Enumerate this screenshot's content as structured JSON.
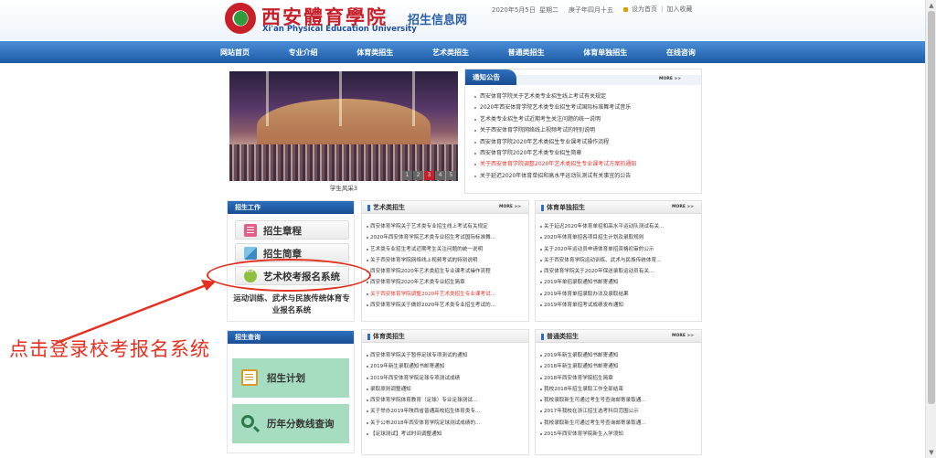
{
  "header": {
    "logo_cn": "西安體育學院",
    "logo_en": "Xi'an Physical Education University",
    "site_name": "招生信息网",
    "date": "2020年5月5日",
    "weekday": "星期二",
    "lunar": "庚子年四月十五",
    "links": [
      "设为首页",
      "加入收藏"
    ]
  },
  "nav": [
    "网站首页",
    "专业介绍",
    "体育类招生",
    "艺术类招生",
    "普通类招生",
    "体育单独招生",
    "在线咨询"
  ],
  "photo": {
    "caption": "学生风采3",
    "dots": [
      "1",
      "2",
      "3",
      "4",
      "5"
    ],
    "active_dot": 2
  },
  "notice": {
    "title": "通知公告",
    "more": "MORE >>",
    "items": [
      "西安体育学院关于艺术类专业招生线上考试有关规定",
      "2020年西安体育学院艺术类专业招生考试国际标准舞考试音乐",
      "艺术类专业招生考试近期考生关注问题的统一说明",
      "关于西安体育学院网络线上视频考试的特别说明",
      "西安体育学院2020年艺术类招生专业课考试操作流程",
      "西安体育学院2020年艺术类专业招生简章",
      "关于西安体育学院调整2020年艺术类招生专业课考试方案的通知",
      "关于延迟2020年体育单招和高水平运动队测试有关事宜的公告"
    ],
    "red_index": 6
  },
  "work": {
    "title": "招生工作",
    "buttons": [
      "招生章程",
      "招生简章",
      "艺术校考报名系统"
    ],
    "extra": "运动训练、武术与民族传统体育专业报名系统"
  },
  "query": {
    "title": "招生查询",
    "buttons": [
      "招生计划",
      "历年分数线查询"
    ]
  },
  "art_box": {
    "title": "艺术类招生",
    "more": "MORE >>",
    "items": [
      "西安体育学院关于艺术类专业招生线上考试有关规定",
      "2020年西安体育学院艺术类专业招生考试国际标准舞...",
      "艺术类专业招生考试近期考生关注问题的统一说明",
      "关于西安体育学院网络线上视频考试的特别说明",
      "西安体育学院2020年艺术类招生专业课考试操作流程",
      "西安体育学院2020年艺术类专业招生简章",
      "关于西安体育学院调整2020年艺术类招生专业课考试...",
      "西安体育学院关于做好2020年艺术类专业招生考试的..."
    ],
    "red_index": 6
  },
  "sport_single_box": {
    "title": "体育单独招生",
    "more": "MORE >>",
    "items": [
      "关于延迟2020年体育单招和高水平运动队测试有关...",
      "2020年体育单招各项目招生计划及录取规则",
      "关于2020年运动员申请体育单招资格初审的公示",
      "关于西安体育学院运动训练、武术与民族传统体育...",
      "西安体育学院关于2020年保送录取运动员有关...",
      "2019年单招录取通知书邮寄通知",
      "2019年体育单招录取办法及录取结果",
      "2019年体育单招考试成绩发布通知"
    ]
  },
  "sport_box": {
    "title": "体育类招生",
    "items": [
      "西安体育学院关于暂停足球专项测试的通知",
      "2019年新生录取通知书邮寄通知",
      "2019年西安体育学院足球专项测试成绩",
      "录取原则调整通知",
      "西安体育学院体育教育（足球）专业足球测试...",
      "关于举办2019年陕西省普通高校招生体育类专...",
      "关于公布2018年西安体育学院足球测试成绩的...",
      "【足球测试】考试时间调整通知"
    ]
  },
  "general_box": {
    "title": "普通类招生",
    "more": "MORE >>",
    "items": [
      "2019年新生录取通知书邮寄通知",
      "2018年新生录取通知书邮寄通知",
      "2018年西安体育学院招生简章",
      "我校2018年招生录取工作全部结束",
      "我校录取新生可通过考生号查询邮寄录取通...",
      "2017年我校在浙江招生选考科目范围公示",
      "我校录取新生可通过考生号查询邮寄录取通...",
      "2015年西安体育学院新生入学须知"
    ]
  },
  "annotation": {
    "text": "点击登录校考报名系统",
    "color": "#e53020"
  }
}
